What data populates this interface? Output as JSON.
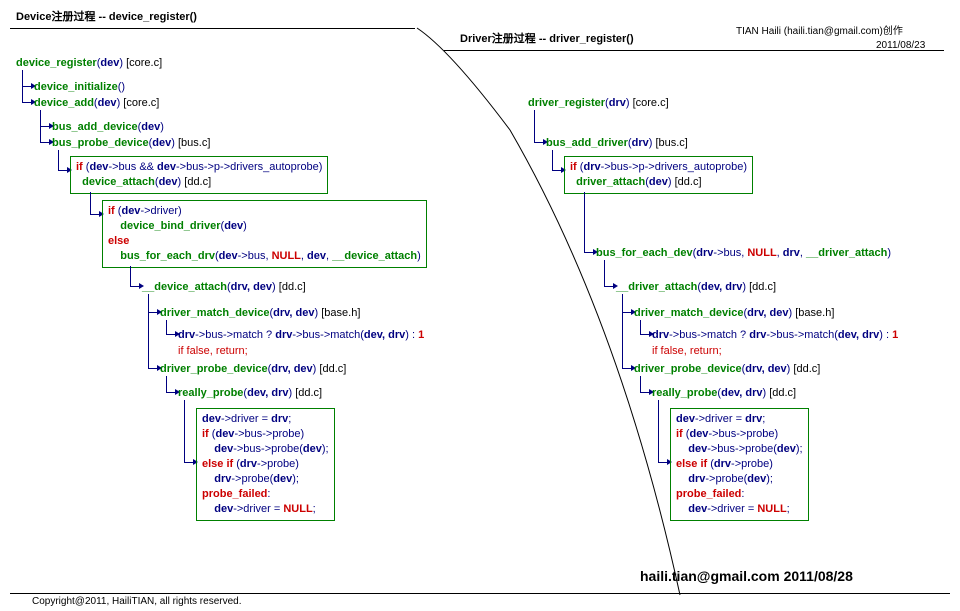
{
  "left_title": "Device注册过程 -- device_register()",
  "right_title": "Driver注册过程 -- driver_register()",
  "credit_name": "TIAN Haili (haili.tian@gmail.com)创作",
  "credit_date": "2011/08/23",
  "copyright": "Copyright@2011, HailiTIAN, all rights reserved.",
  "watermark": "haili.tian@gmail.com 2011/08/28",
  "L": {
    "l1_fn": "device_register",
    "l1_arg": "dev",
    "l1_file": "[core.c]",
    "l2_fn": "device_initialize",
    "l3_fn": "device_add",
    "l3_arg": "dev",
    "l3_file": "[core.c]",
    "l4_fn": "bus_add_device",
    "l4_arg": "dev",
    "l5_fn": "bus_probe_device",
    "l5_arg": "dev",
    "l5_file": "[bus.c]",
    "l6_if": "if",
    "l6_a": "dev",
    "l6_b": "->bus && ",
    "l6_c": "dev",
    "l6_d": "->bus->p->drivers_autoprobe)",
    "l7_fn": "device_attach",
    "l7_arg": "dev",
    "l7_file": "[dd.c]",
    "l8_if": "if",
    "l8_arg": "dev",
    "l8_d": "->driver)",
    "l9_fn": "device_bind_driver",
    "l9_arg": "dev",
    "l10_else": "else",
    "l11_fn": "bus_for_each_drv",
    "l11_a": "dev",
    "l11_b": "->bus, ",
    "l11_null": "NULL",
    "l11_c": ", ",
    "l11_d": "dev",
    "l11_e": ", ",
    "l11_f": "__device_attach",
    "l12_fn": "__device_attach",
    "l12_args": "drv, dev",
    "l12_file": "[dd.c]",
    "l13_fn": "driver_match_device",
    "l13_args": "drv, dev",
    "l13_file": "[base.h]",
    "l14_a": "drv",
    "l14_b": "->bus->match ? ",
    "l14_c": "drv",
    "l14_d": "->bus->match(",
    "l14_e": "dev, drv",
    "l14_f": ") : ",
    "l14_g": "1",
    "l15": "if false, return;",
    "l16_fn": "driver_probe_device",
    "l16_args": "drv, dev",
    "l16_file": "[dd.c]",
    "l17_fn": "really_probe",
    "l17_args": "dev, drv",
    "l17_file": "[dd.c]",
    "b1": "dev",
    "b1b": "->driver = ",
    "b1c": "drv",
    "b1d": ";",
    "b2_if": "if",
    "b2a": "dev",
    "b2b": "->bus->probe)",
    "b3a": "dev",
    "b3b": "->bus->probe(",
    "b3c": "dev",
    "b3d": ");",
    "b4_elif": "else if",
    "b4a": "drv",
    "b4b": "->probe)",
    "b5a": "drv",
    "b5b": "->probe(",
    "b5c": "dev",
    "b5d": ");",
    "b6": "probe_failed",
    "b6b": ":",
    "b7a": "dev",
    "b7b": "->driver = ",
    "b7c": "NULL",
    "b7d": ";"
  },
  "R": {
    "r1_fn": "driver_register",
    "r1_arg": "drv",
    "r1_file": "[core.c]",
    "r2_fn": "bus_add_driver",
    "r2_arg": "drv",
    "r2_file": "[bus.c]",
    "r3_if": "if",
    "r3_a": "drv",
    "r3_b": "->bus->p->drivers_autoprobe)",
    "r4_fn": "driver_attach",
    "r4_arg": "dev",
    "r4_file": "[dd.c]",
    "r5_fn": "bus_for_each_dev",
    "r5_a": "drv",
    "r5_b": "->bus, ",
    "r5_null": "NULL",
    "r5_c": ", ",
    "r5_d": "drv",
    "r5_e": ", ",
    "r5_f": "__driver_attach",
    "r6_fn": "__driver_attach",
    "r6_args": "dev, drv",
    "r6_file": "[dd.c]",
    "r7_fn": "driver_match_device",
    "r7_args": "drv, dev",
    "r7_file": "[base.h]",
    "r8_a": "drv",
    "r8_b": "->bus->match ? ",
    "r8_c": "drv",
    "r8_d": "->bus->match(",
    "r8_e": "dev, drv",
    "r8_f": ") : ",
    "r8_g": "1",
    "r9": "if false, return;",
    "r10_fn": "driver_probe_device",
    "r10_args": "drv, dev",
    "r10_file": "[dd.c]",
    "r11_fn": "really_probe",
    "r11_args": "dev, drv",
    "r11_file": "[dd.c]"
  }
}
